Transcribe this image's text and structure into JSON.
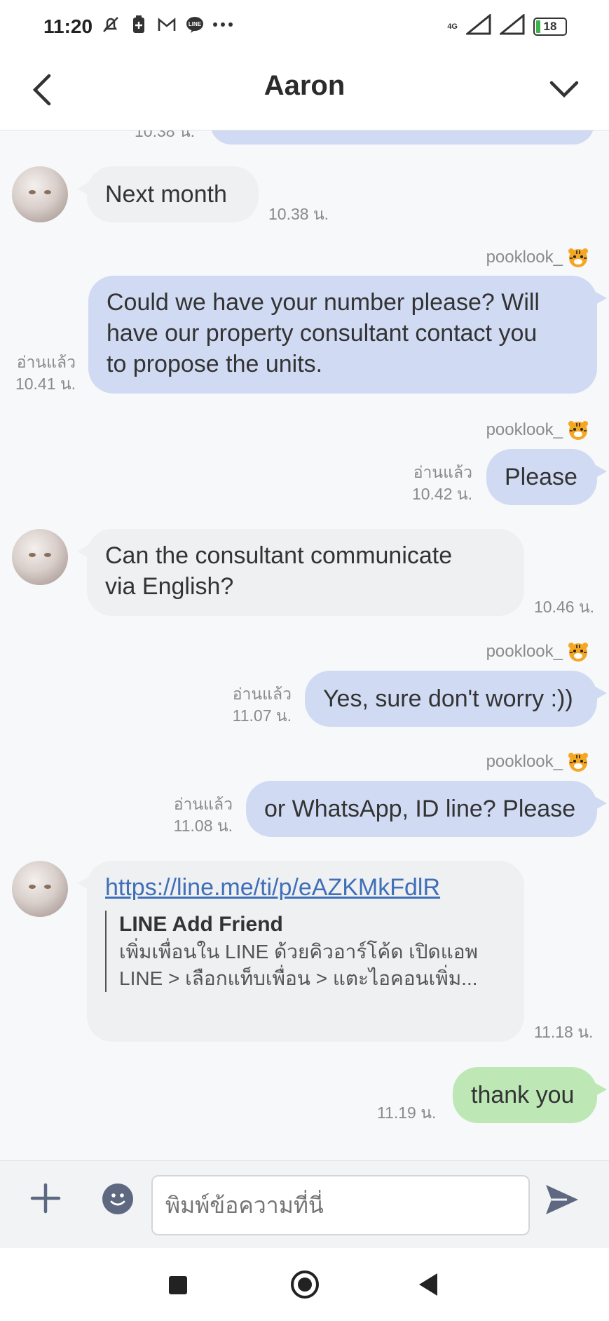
{
  "status_bar": {
    "time": "11:20",
    "network": "4G",
    "battery": "18"
  },
  "header": {
    "title": "Aaron"
  },
  "messages": {
    "partial_time": "10.38 น.",
    "m1": {
      "text": "Next month",
      "time": "10.38 น."
    },
    "m2": {
      "sender": "pooklook_",
      "line1": "Could we have your number please? Will",
      "line2": "have our property consultant contact you",
      "line3": "to propose the units.",
      "read": "อ่านแล้ว",
      "time": "10.41 น."
    },
    "m3": {
      "sender": "pooklook_",
      "text": "Please",
      "read": "อ่านแล้ว",
      "time": "10.42 น."
    },
    "m4": {
      "line1": "Can the consultant communicate",
      "line2": "via English?",
      "time": "10.46 น."
    },
    "m5": {
      "sender": "pooklook_",
      "text": "Yes, sure don't worry :))",
      "read": "อ่านแล้ว",
      "time": "11.07 น."
    },
    "m6": {
      "sender": "pooklook_",
      "text": "or WhatsApp, ID line? Please",
      "read": "อ่านแล้ว",
      "time": "11.08 น."
    },
    "m7": {
      "link": "https://line.me/ti/p/eAZKMkFdlR",
      "preview_title": "LINE Add Friend",
      "preview_line1": "เพิ่มเพื่อนใน LINE ด้วยคิวอาร์โค้ด เปิดแอพ",
      "preview_line2": "LINE > เลือกแท็บเพื่อน > แตะไอคอนเพิ่ม...",
      "time": "11.18 น."
    },
    "m8": {
      "text": "thank you",
      "time": "11.19 น."
    }
  },
  "input": {
    "placeholder": "พิมพ์ข้อความที่นี่"
  },
  "colors": {
    "incoming_bubble": "#eff0f2",
    "outgoing_bubble": "#d0dbf3",
    "unread_bubble": "#bde8b6",
    "link": "#3f6fb8"
  }
}
